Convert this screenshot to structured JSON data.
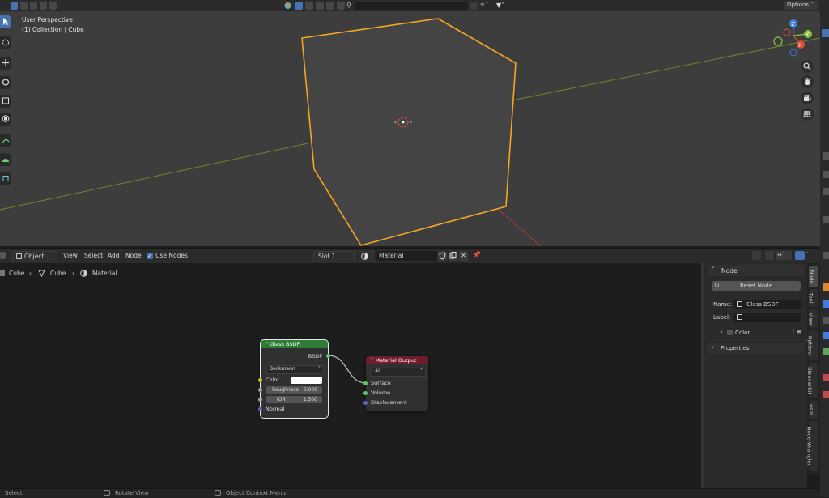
{
  "viewport": {
    "header": {
      "options_label": "Options",
      "search_value": ""
    },
    "perspective_label": "User Perspective",
    "collection_label": "(1) Collection | Cube",
    "gizmo": {
      "z": "Z",
      "y": "Y",
      "x": "X"
    }
  },
  "node_editor": {
    "header": {
      "mode": "Object",
      "menus": [
        "View",
        "Select",
        "Add",
        "Node"
      ],
      "use_nodes_label": "Use Nodes",
      "use_nodes_checked": true,
      "slot": "Slot 1",
      "material_name": "Material"
    },
    "breadcrumb": [
      "Cube",
      "Cube",
      "Material"
    ],
    "glass_node": {
      "title": "Glass BSDF",
      "output": "BSDF",
      "distribution": "Beckmann",
      "color_label": "Color",
      "roughness_label": "Roughness",
      "roughness_value": "0.000",
      "ior_label": "IOR",
      "ior_value": "1.500",
      "normal_label": "Normal",
      "color_value": "#ffffff"
    },
    "output_node": {
      "title": "Material Output",
      "target": "All",
      "inputs": [
        "Surface",
        "Volume",
        "Displacement"
      ]
    }
  },
  "sidebar": {
    "panel_title": "Node",
    "reset_button": "Reset Node",
    "name_label": "Name:",
    "name_value": "Glass BSDF",
    "label_label": "Label:",
    "label_value": "",
    "color_label": "Color",
    "properties_label": "Properties",
    "tabs": [
      "Node",
      "Tool",
      "View",
      "Options",
      "BlenderKit",
      "osm",
      "Node Wrangler"
    ]
  },
  "statusbar": {
    "items": [
      "Select",
      "Rotate View",
      "Object Context Menu"
    ]
  },
  "colors": {
    "selection_orange": "#f5a623",
    "active_blue": "#4772b3",
    "shader_header_green": "#2f7a35",
    "output_header_red": "#6e1d2d",
    "socket_yellow": "#c7c729",
    "socket_grey": "#a1a1a1",
    "socket_purple": "#6363c7",
    "socket_green": "#63c763"
  }
}
